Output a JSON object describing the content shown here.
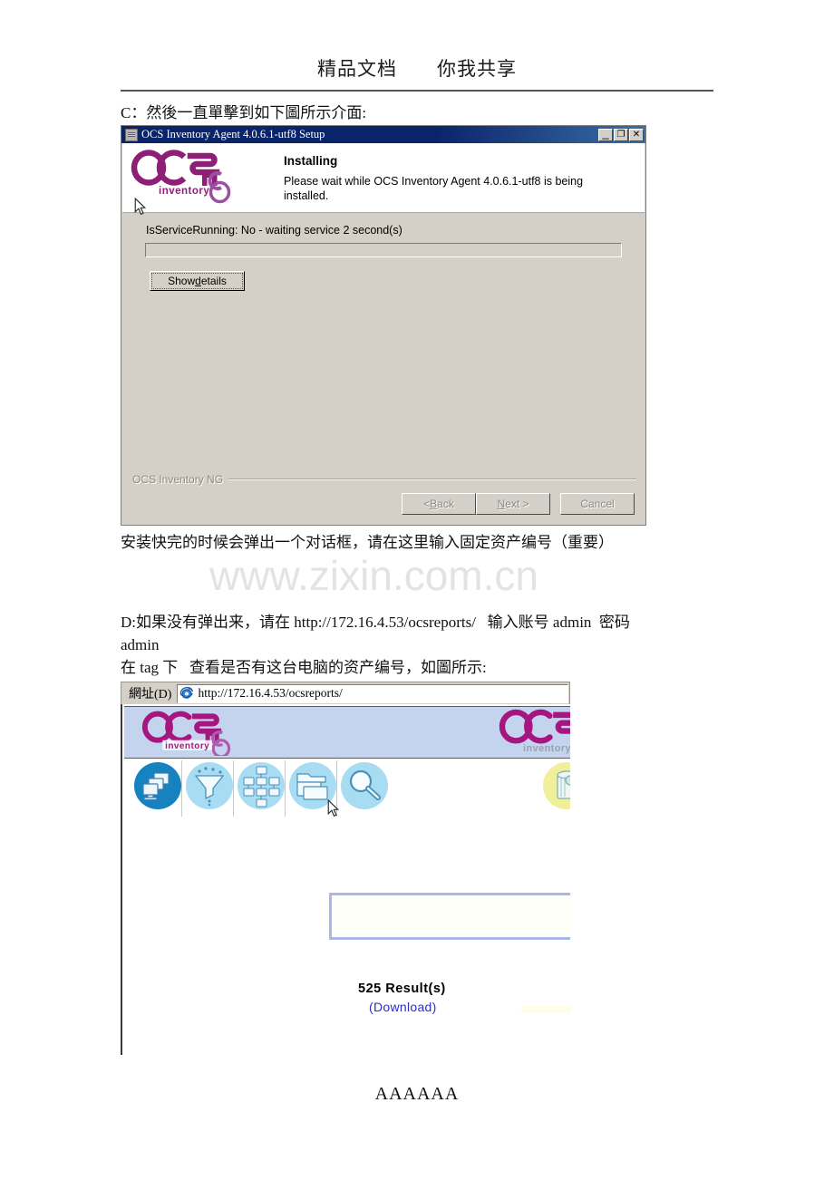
{
  "document": {
    "header_left": "精品文档",
    "header_right": "你我共享",
    "paragraph_c": "C：然後一直單擊到如下圖所示介面:",
    "paragraph_after_installer": "安装快完的时候会弹出一个对话框，请在这里输入固定资产编号（重要）",
    "paragraph_d_line1": "D:如果没有弹出来，请在 http://172.16.4.53/ocsreports/   输入账号 admin  密码",
    "paragraph_d_line2": "admin",
    "paragraph_tag": "在 tag 下   查看是否有这台电脑的资产编号，如圖所示:",
    "watermark": "www.zixin.com.cn",
    "footer": "AAAAAA"
  },
  "installer": {
    "title": "OCS Inventory Agent 4.0.6.1-utf8 Setup",
    "app_icon": "setup-app-icon",
    "caption_buttons": [
      {
        "name": "minimize-button",
        "glyph": "_"
      },
      {
        "name": "maximize-button",
        "glyph": "❐"
      },
      {
        "name": "close-button",
        "glyph": "✕"
      }
    ],
    "logo_text_main": "OCS",
    "logo_text_ng": "NG",
    "logo_text_sub": "inventory",
    "heading": "Installing",
    "subheading": "Please wait while OCS Inventory Agent 4.0.6.1-utf8 is being installed.",
    "status_text": "IsServiceRunning: No  - waiting service 2 second(s)",
    "progress_percent": 0,
    "show_details_label_pre": "Show ",
    "show_details_label_accel": "d",
    "show_details_label_post": "etails",
    "branding": "OCS Inventory NG",
    "buttons": [
      {
        "name": "back-button",
        "pre": "< ",
        "accel": "B",
        "post": "ack",
        "disabled": true
      },
      {
        "name": "next-button",
        "pre": "",
        "accel": "N",
        "post": "ext >",
        "disabled": true
      },
      {
        "name": "cancel-button",
        "pre": "Cancel",
        "accel": "",
        "post": "",
        "disabled": true
      }
    ],
    "colors": {
      "titlebar": "#0a246a",
      "face": "#d4d0c8",
      "logo_purple": "#8e1f76"
    }
  },
  "browser": {
    "address_label": "網址(D)",
    "address_url": "http://172.16.4.53/ocsreports/",
    "browser_icon": "internet-explorer-icon",
    "banner_logo_text_main": "OCS",
    "banner_logo_text_ng": "NG",
    "banner_logo_text_sub": "inventory",
    "toolbar_items": [
      {
        "name": "toolbar-icon-computers",
        "icon": "computers-icon",
        "active": true
      },
      {
        "name": "toolbar-icon-filter",
        "icon": "funnel-filter-icon",
        "active": false
      },
      {
        "name": "toolbar-icon-network",
        "icon": "network-tree-icon",
        "active": false
      },
      {
        "name": "toolbar-icon-groups",
        "icon": "stacked-windows-icon",
        "active": false
      },
      {
        "name": "toolbar-icon-search",
        "icon": "magnifier-search-icon",
        "active": false
      },
      {
        "name": "toolbar-icon-partial",
        "icon": "barrel-icon",
        "active": false
      }
    ],
    "search_box_value": "",
    "result_count": "525 Result(s)",
    "download_label": "(Download)",
    "colors": {
      "banner_bg": "#c5d4ee",
      "icon_active": "#1683c0",
      "icon_idle": "#a8dcf2",
      "link": "#2b2bc9"
    }
  }
}
